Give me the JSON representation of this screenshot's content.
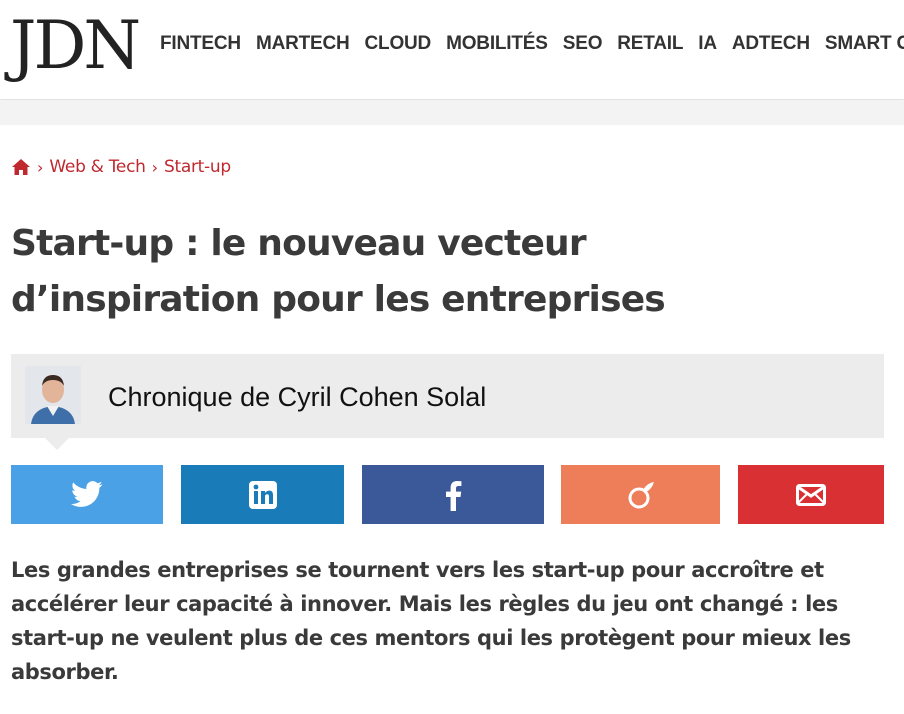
{
  "header": {
    "logo": "JDN",
    "nav": [
      "FINTECH",
      "MARTECH",
      "CLOUD",
      "MOBILITÉS",
      "SEO",
      "RETAIL",
      "IA",
      "ADTECH",
      "SMART C"
    ]
  },
  "breadcrumb": {
    "home_icon": "home-icon",
    "items": [
      "Web & Tech",
      "Start-up"
    ],
    "separator": "›"
  },
  "article": {
    "title_line1": "Start-up : le nouveau vecteur",
    "title_line2": "d’inspiration pour les entreprises",
    "author": "Chronique de Cyril Cohen Solal",
    "lead": "Les grandes entreprises se tournent vers les start-up pour accroître et accélérer leur capacité à innover. Mais les règles du jeu ont changé : les start-up ne veulent plus de ces mentors qui les protègent pour mieux les absorber."
  },
  "share": [
    {
      "network": "twitter",
      "icon": "twitter-icon",
      "color": "#4aa1e6"
    },
    {
      "network": "linkedin",
      "icon": "linkedin-icon",
      "color": "#1a7bb9"
    },
    {
      "network": "facebook",
      "icon": "facebook-icon",
      "color": "#3b5998"
    },
    {
      "network": "viadeo",
      "icon": "viadeo-icon",
      "color": "#ee7d5a"
    },
    {
      "network": "email",
      "icon": "mail-icon",
      "color": "#d93034"
    }
  ],
  "colors": {
    "accent": "#c0282f",
    "title": "#3a3a3a",
    "author_box": "#ececec"
  }
}
